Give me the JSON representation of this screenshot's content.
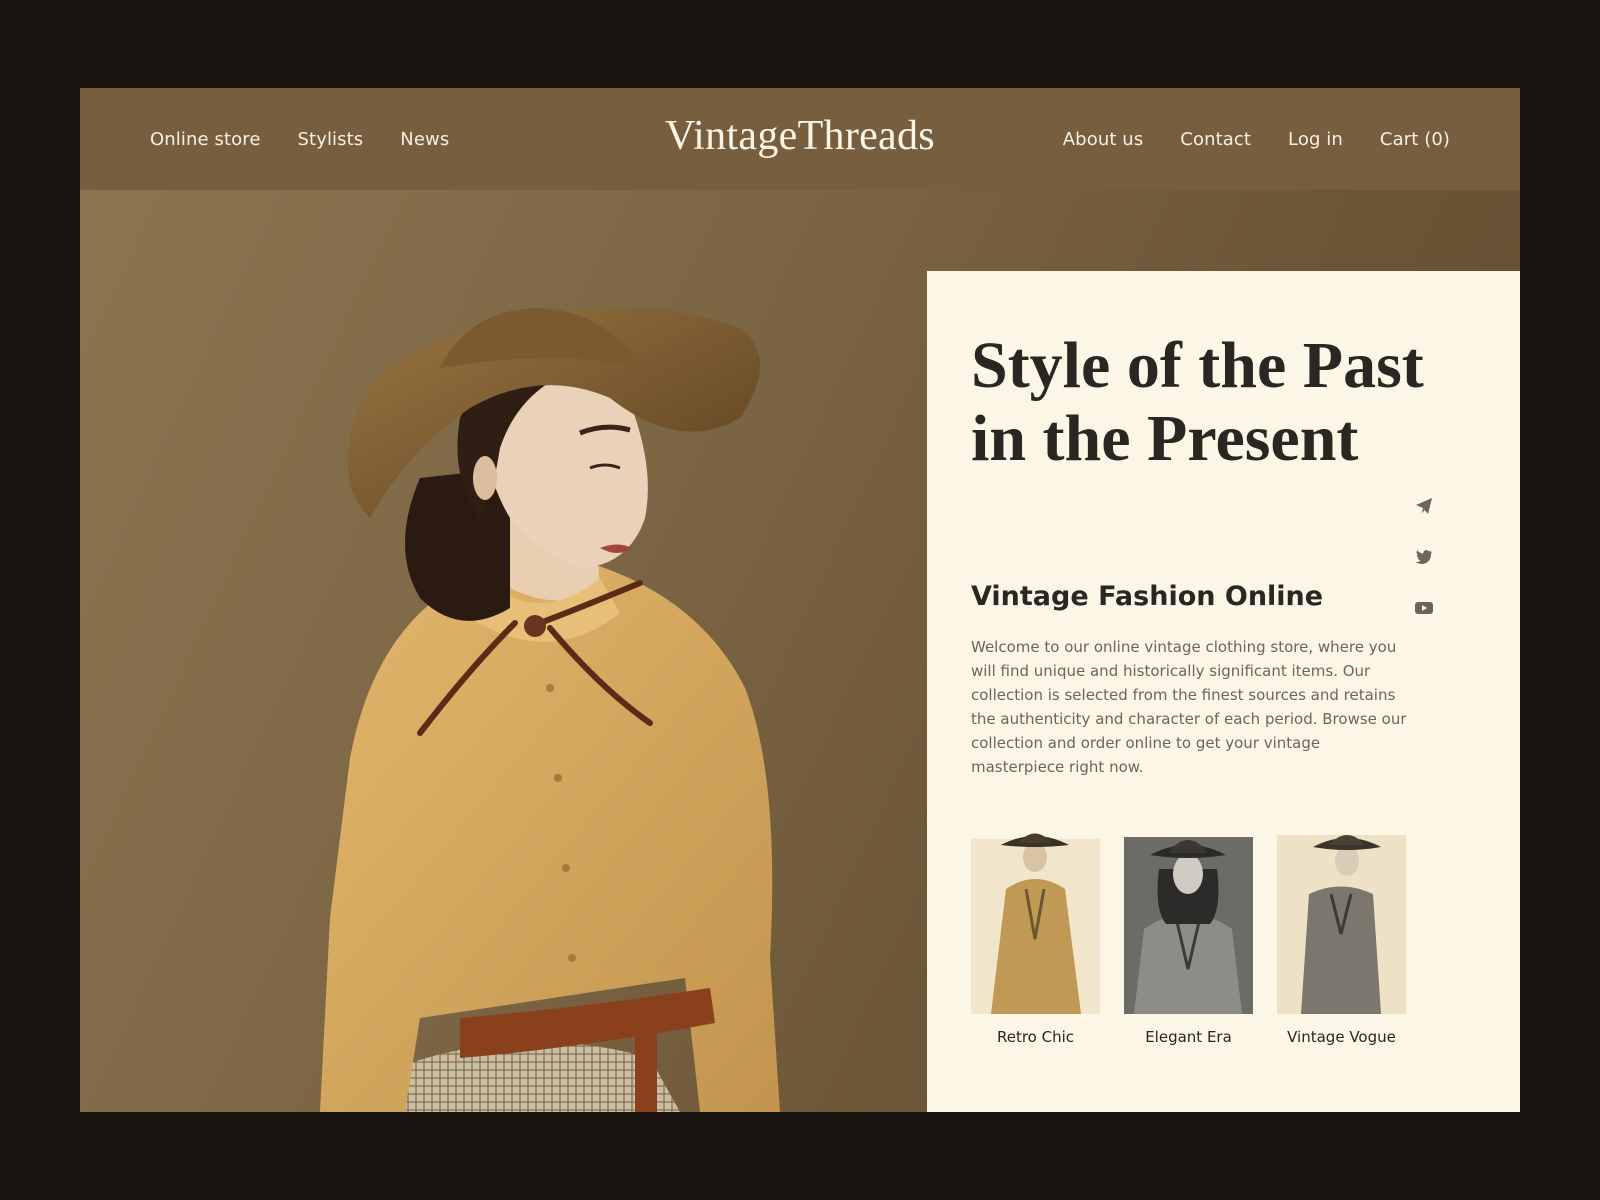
{
  "brand": {
    "logo": "VintageThreads"
  },
  "nav": {
    "left": [
      "Online store",
      "Stylists",
      "News"
    ],
    "right": [
      "About us",
      "Contact",
      "Log in",
      "Cart (0)"
    ]
  },
  "hero": {
    "title_line1": "Style of the Past",
    "title_line2": "in the Present",
    "subtitle": "Vintage Fashion Online",
    "description": "Welcome to our online vintage clothing store, where you will find unique and historically significant items. Our collection is selected from the finest sources and retains the authenticity and character of each period. Browse our collection and order online to get your vintage masterpiece right now."
  },
  "social": [
    "telegram-icon",
    "twitter-icon",
    "youtube-icon"
  ],
  "products": [
    {
      "name": "Retro Chic",
      "tone": "sepia"
    },
    {
      "name": "Elegant Era",
      "tone": "gray"
    },
    {
      "name": "Vintage Vogue",
      "tone": "cream"
    }
  ],
  "colors": {
    "page_bg": "#1a1510",
    "nav_bg": "#775e3f",
    "panel_bg": "#fcf6e6",
    "heading": "#2a2622",
    "body_text": "#6b655c"
  }
}
